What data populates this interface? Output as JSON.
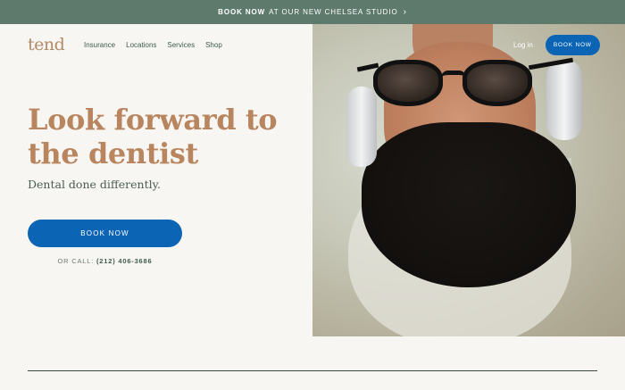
{
  "promo": {
    "strong": "BOOK NOW",
    "text": "AT OUR NEW CHELSEA STUDIO",
    "chevron": "›"
  },
  "brand": {
    "logo": "tend"
  },
  "nav": {
    "items": [
      "Insurance",
      "Locations",
      "Services",
      "Shop"
    ]
  },
  "header_right": {
    "login": "Log in",
    "book": "BOOK NOW"
  },
  "hero": {
    "title_line1": "Look forward to",
    "title_line2": "the dentist",
    "subtitle": "Dental done differently.",
    "cta": "BOOK NOW",
    "call_label": "OR CALL:",
    "phone": "(212) 406-3686"
  },
  "colors": {
    "promo_bg": "#5e7a6d",
    "accent_blue": "#0c64b4",
    "title_brown": "#b8855f",
    "page_bg": "#f7f6f2"
  }
}
